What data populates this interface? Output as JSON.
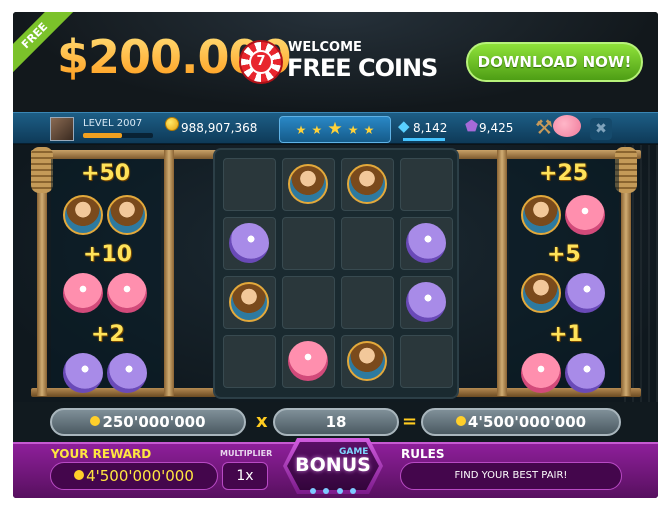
{
  "banner": {
    "ribbon": "FREE",
    "amount": "$200.000",
    "logo_glyph": "7",
    "welcome": "WELCOME",
    "free_coins": "FREE COINS",
    "download_label": "DOWNLOAD NOW!"
  },
  "status": {
    "level": "LEVEL 2007",
    "level_progress": 0.55,
    "coins": "988,907,368",
    "stars": [
      "★",
      "★",
      "★",
      "★",
      "★"
    ],
    "gems": "8,142",
    "shields": "9,425",
    "close_glyph": "✖",
    "colors": {
      "bar": "#1d5e86",
      "gold": "#ffd23a"
    }
  },
  "paytable": {
    "left": [
      {
        "value": "+50",
        "symbol": "pirate-icon"
      },
      {
        "value": "+10",
        "symbol": "octopus-icon"
      },
      {
        "value": "+2",
        "symbol": "blowfish-icon"
      }
    ],
    "right": [
      {
        "value": "+25",
        "symbol": "pirate-octopus-pair"
      },
      {
        "value": "+5",
        "symbol": "pirate-blowfish-pair"
      },
      {
        "value": "+1",
        "symbol": "octopus-blowfish-pair"
      }
    ]
  },
  "board": {
    "rows": 4,
    "cols": 4,
    "cells": [
      "empty",
      "pirate",
      "pirate",
      "empty",
      "blowfish",
      "empty",
      "empty",
      "blowfish",
      "pirate",
      "empty",
      "empty",
      "blowfish",
      "empty",
      "octopus",
      "pirate",
      "empty"
    ]
  },
  "calc": {
    "bet": "250'000'000",
    "times": "x",
    "multiplier": "18",
    "equals": "=",
    "total": "4'500'000'000"
  },
  "bottom": {
    "reward_label": "YOUR REWARD",
    "reward_value": "4'500'000'000",
    "multiplier_label": "MULTIPLIER",
    "multiplier_value": "1x",
    "bonus_game": "GAME",
    "bonus_word": "BONUS",
    "rules_label": "RULES",
    "rules_text": "FIND YOUR BEST PAIR!",
    "colors": {
      "accent": "#8e1f9a",
      "reward": "#ffe640"
    }
  }
}
